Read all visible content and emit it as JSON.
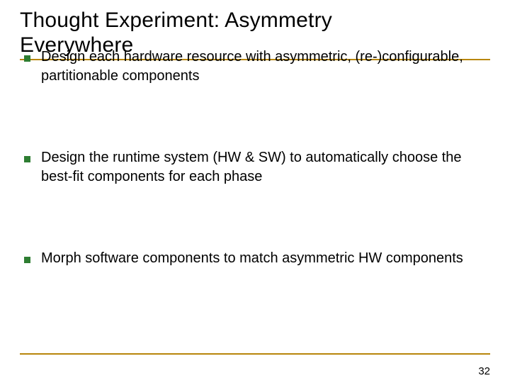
{
  "title_line1": "Thought Experiment: Asymmetry",
  "title_line2": "Everywhere",
  "bullets": [
    "Design each hardware resource with asymmetric, (re-)configurable, partitionable components",
    "Design the runtime system (HW & SW) to automatically choose the best-fit components for each phase",
    "Morph software components to match asymmetric HW components"
  ],
  "page_number": "32"
}
